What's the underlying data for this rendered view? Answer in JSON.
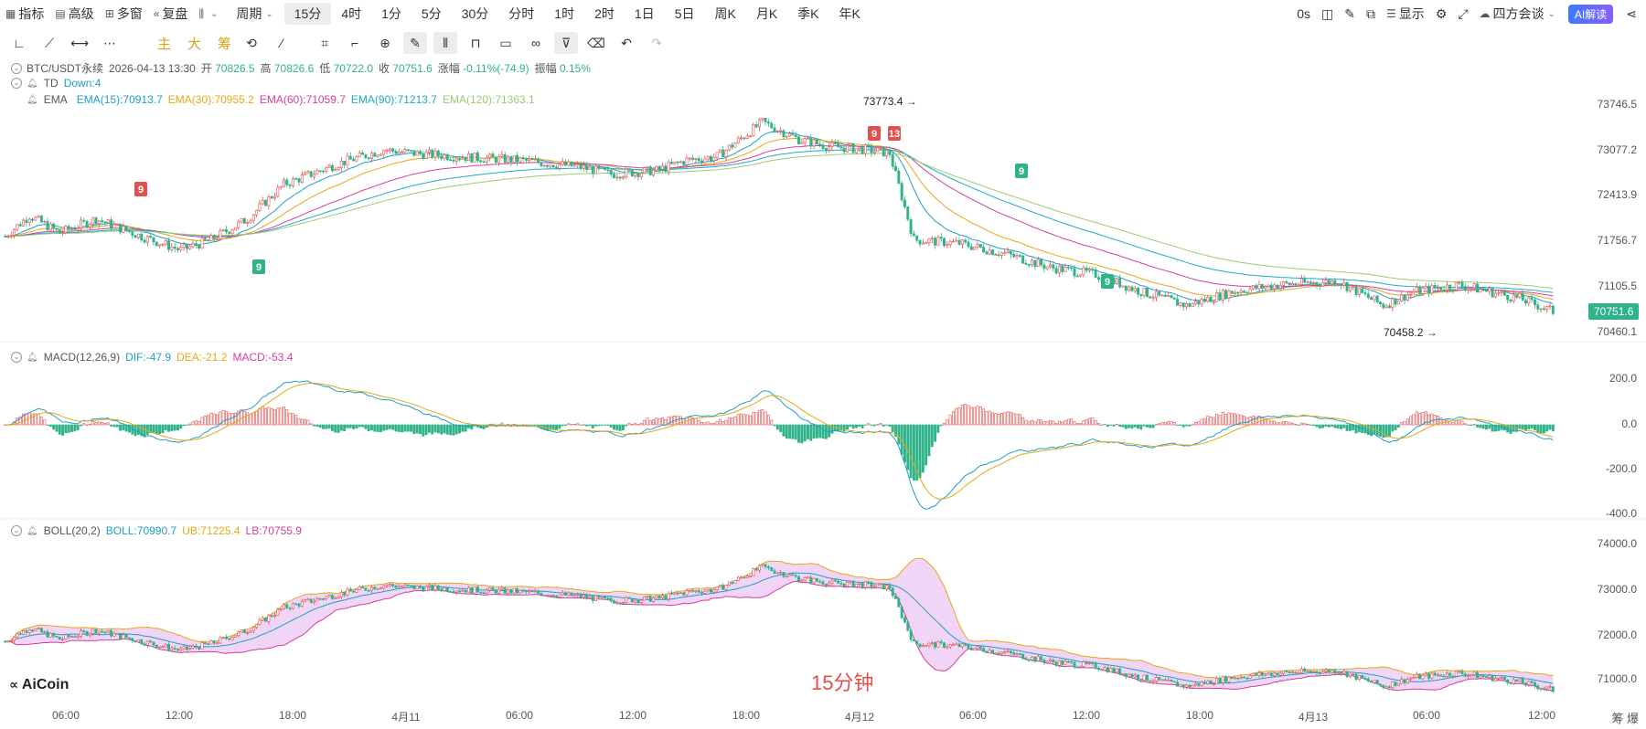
{
  "topbar": {
    "items": [
      {
        "name": "indicator-button",
        "icon": "chart-icon",
        "icon_glyph": "▦",
        "label": "指标"
      },
      {
        "name": "advanced-button",
        "icon": "chart-icon",
        "icon_glyph": "▤",
        "label": "高级"
      },
      {
        "name": "multi-window-button",
        "icon": "grid-icon",
        "icon_glyph": "⊞",
        "label": "多窗"
      },
      {
        "name": "replay-button",
        "icon": "rewind-icon",
        "icon_glyph": "⏪",
        "label": "复盘"
      },
      {
        "name": "chart-type-button",
        "icon": "candle-icon",
        "icon_glyph": "⫼",
        "label": ""
      }
    ],
    "period_label": "周期",
    "periods": [
      "15分",
      "4时",
      "1分",
      "5分",
      "30分",
      "分时",
      "1时",
      "2时",
      "1日",
      "5日",
      "周K",
      "月K",
      "季K",
      "年K"
    ],
    "active_period": "15分",
    "right": {
      "countdown": "0s",
      "display_label": "显示",
      "layout_label": "四方会谈",
      "ai_label": "AI解读"
    }
  },
  "toolbar2": {
    "tags": [
      "主",
      "大",
      "筹"
    ]
  },
  "info": {
    "symbol": "BTC/USDT永续",
    "datetime": "2026-04-13 13:30",
    "open_label": "开",
    "open": "70826.5",
    "high_label": "高",
    "high": "70826.6",
    "low_label": "低",
    "low": "70722.0",
    "close_label": "收",
    "close": "70751.6",
    "change_label": "涨幅",
    "change": "-0.11%(-74.9)",
    "amp_label": "振幅",
    "amp": "0.15%"
  },
  "td": {
    "name": "TD",
    "value": "Down:4"
  },
  "ema": {
    "name": "EMA",
    "items": [
      {
        "label": "EMA(15):70913.7",
        "color": "#1f9ec9"
      },
      {
        "label": "EMA(30):70955.2",
        "color": "#e6a817"
      },
      {
        "label": "EMA(60):71059.7",
        "color": "#d23f9b"
      },
      {
        "label": "EMA(90):71213.7",
        "color": "#1fa9c9"
      },
      {
        "label": "EMA(120):71363.1",
        "color": "#9acb73"
      }
    ]
  },
  "macd": {
    "name": "MACD(12,26,9)",
    "dif": "DIF:-47.9",
    "dea": "DEA:-21.2",
    "macd": "MACD:-53.4"
  },
  "boll": {
    "name": "BOLL(20,2)",
    "boll": "BOLL:70990.7",
    "ub": "UB:71225.4",
    "lb": "LB:70755.9"
  },
  "main_axis": [
    "73746.5",
    "73077.2",
    "72413.9",
    "71756.7",
    "71105.5",
    "70460.1"
  ],
  "macd_axis": [
    "200.0",
    "0.0",
    "-200.0",
    "-400.0"
  ],
  "boll_axis": [
    "74000.0",
    "73000.0",
    "72000.0",
    "71000.0"
  ],
  "current_price": "70751.6",
  "high_marker": "73773.4 →",
  "low_marker": "70458.2 →",
  "td_marks": [
    "9",
    "9",
    "9",
    "13",
    "9",
    "9"
  ],
  "watermark": "15分钟",
  "logo": "AiCoin",
  "x_ticks": [
    "06:00",
    "12:00",
    "18:00",
    "4月11",
    "06:00",
    "12:00",
    "18:00",
    "4月12",
    "06:00",
    "12:00",
    "18:00",
    "4月13",
    "06:00",
    "12:00"
  ],
  "footer": "筹 爆",
  "colors": {
    "up": "#e0504d",
    "down": "#2fb38a",
    "accent": "#3f7bff"
  }
}
